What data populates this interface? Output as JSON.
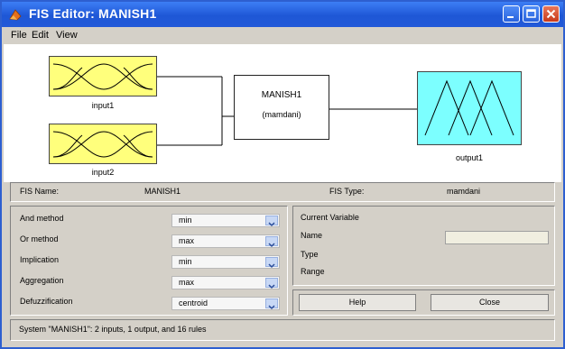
{
  "window": {
    "title": "FIS Editor: MANISH1",
    "controls": [
      "minimize-icon",
      "maximize-icon",
      "close-icon"
    ]
  },
  "menu": [
    "File",
    "Edit",
    "View"
  ],
  "diagram": {
    "inputs": [
      "input1",
      "input2"
    ],
    "system_name": "MANISH1",
    "system_type": "(mamdani)",
    "output": "output1"
  },
  "fis_info": {
    "name_label": "FIS Name:",
    "name_value": "MANISH1",
    "type_label": "FIS Type:",
    "type_value": "mamdani"
  },
  "methods": [
    {
      "label": "And method",
      "value": "min"
    },
    {
      "label": "Or method",
      "value": "max"
    },
    {
      "label": "Implication",
      "value": "min"
    },
    {
      "label": "Aggregation",
      "value": "max"
    },
    {
      "label": "Defuzzification",
      "value": "centroid"
    }
  ],
  "current_variable": {
    "title": "Current Variable",
    "name_label": "Name",
    "type_label": "Type",
    "range_label": "Range",
    "name_value": ""
  },
  "buttons": {
    "help": "Help",
    "close": "Close"
  },
  "status": "System \"MANISH1\": 2 inputs, 1 output, and 16 rules",
  "colors": {
    "titlebar": "#1e57d6",
    "input_fill": "#ffff7c",
    "output_fill": "#7cffff",
    "panel": "#d4d0c8"
  }
}
